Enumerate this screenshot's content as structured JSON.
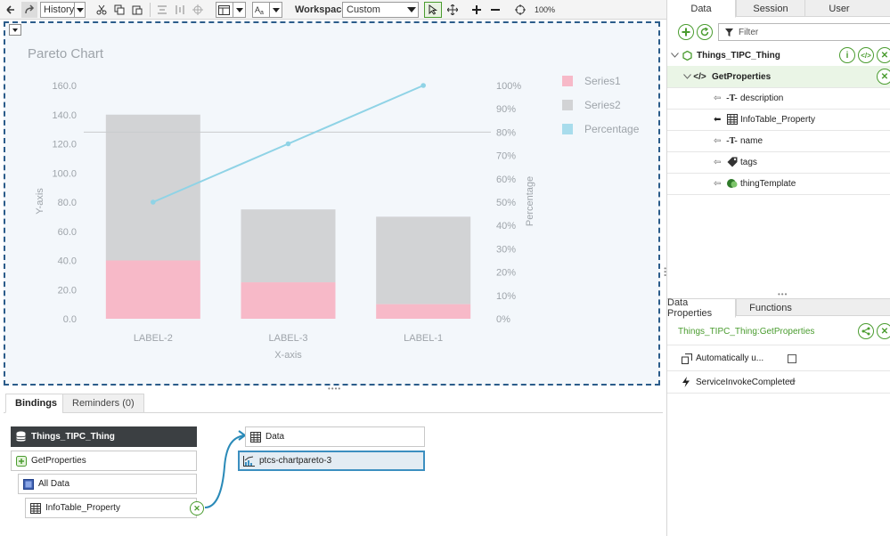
{
  "toolbar": {
    "history_label": "History",
    "workspace_label": "Workspace",
    "workspace_value": "Custom",
    "zoom_level": "100%"
  },
  "chart_data": {
    "type": "bar",
    "title": "Pareto Chart",
    "xlabel": "X-axis",
    "ylabel": "Y-axis",
    "y2label": "Percentage",
    "categories": [
      "LABEL-2",
      "LABEL-3",
      "LABEL-1"
    ],
    "ylim": [
      0,
      160
    ],
    "y_ticks": [
      "0.0",
      "20.0",
      "40.0",
      "60.0",
      "80.0",
      "100.0",
      "120.0",
      "140.0",
      "160.0"
    ],
    "y2lim": [
      0,
      100
    ],
    "y2_ticks": [
      "0%",
      "10%",
      "20%",
      "30%",
      "40%",
      "50%",
      "60%",
      "70%",
      "80%",
      "90%",
      "100%"
    ],
    "stacked": true,
    "series": [
      {
        "name": "Series1",
        "type": "bar",
        "color": "#f7b9c8",
        "values": [
          40,
          25,
          10
        ]
      },
      {
        "name": "Series2",
        "type": "bar",
        "color": "#d2d3d5",
        "values": [
          100,
          50,
          60
        ]
      },
      {
        "name": "Percentage",
        "type": "line",
        "axis": "y2",
        "color": "#8fd3e6",
        "values": [
          50,
          75,
          100
        ]
      }
    ],
    "reference_line_pct": 80,
    "legend_position": "right"
  },
  "bindings": {
    "tabs": [
      "Bindings",
      "Reminders (0)"
    ],
    "source_thing": "Things_TIPC_Thing",
    "service": "GetProperties",
    "all_data": "All Data",
    "infotable": "InfoTable_Property",
    "target_data": "Data",
    "target_widget": "ptcs-chartpareto-3"
  },
  "right_panel": {
    "tabs": [
      "Data",
      "Session",
      "User"
    ],
    "filter_placeholder": "Filter",
    "thing": "Things_TIPC_Thing",
    "service": "GetProperties",
    "properties": [
      "description",
      "InfoTable_Property",
      "name",
      "tags",
      "thingTemplate"
    ],
    "bottom_tabs": [
      "Data Properties",
      "Functions"
    ],
    "service_path": "Things_TIPC_Thing:GetProperties",
    "auto_option": "Automatically u...",
    "event": "ServiceInvokeCompleted"
  }
}
